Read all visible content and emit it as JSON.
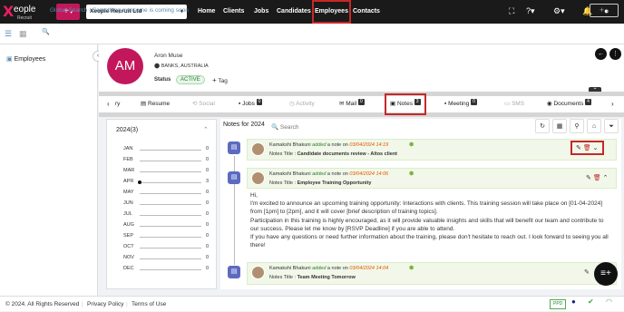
{
  "brand": {
    "logo_letter": "X",
    "logo_text": "eople",
    "logo_sub": "Recruit"
  },
  "topbar": {
    "add_label": "+",
    "company": "Xeople Recruit Ltd",
    "nav": [
      {
        "label": "Home"
      },
      {
        "label": "Clients"
      },
      {
        "label": "Jobs"
      },
      {
        "label": "Candidates"
      },
      {
        "label": "Employees"
      },
      {
        "label": "Contacts"
      }
    ]
  },
  "search": {
    "placeholder": "Global Search - Something awesome is coming soon"
  },
  "sidebar": {
    "item": "Employees"
  },
  "profile": {
    "initials": "AM",
    "name": "Aron Muse",
    "location": "BANKS, AUSTRALIA",
    "status_label": "Status",
    "status": "ACTIVE",
    "tag_label": "Tag"
  },
  "tabs": [
    {
      "label": "ry"
    },
    {
      "label": "Resume"
    },
    {
      "label": "Social"
    },
    {
      "label": "Jobs",
      "count": "0"
    },
    {
      "label": "Activity"
    },
    {
      "label": "Mail",
      "count": "0"
    },
    {
      "label": "Notes",
      "count": "3"
    },
    {
      "label": "Meeting",
      "count": "0"
    },
    {
      "label": "SMS"
    },
    {
      "label": "Documents",
      "count": "4"
    }
  ],
  "year": {
    "label": "2024(3)"
  },
  "months": [
    {
      "m": "JAN",
      "c": "0"
    },
    {
      "m": "FEB",
      "c": "0"
    },
    {
      "m": "MAR",
      "c": "0"
    },
    {
      "m": "APR",
      "c": "3"
    },
    {
      "m": "MAY",
      "c": "0"
    },
    {
      "m": "JUN",
      "c": "0"
    },
    {
      "m": "JUL",
      "c": "0"
    },
    {
      "m": "AUG",
      "c": "0"
    },
    {
      "m": "SEP",
      "c": "0"
    },
    {
      "m": "OCT",
      "c": "0"
    },
    {
      "m": "NOV",
      "c": "0"
    },
    {
      "m": "DEC",
      "c": "0"
    }
  ],
  "notes_header": "Notes for 2024",
  "notes_search": "Search",
  "notes": [
    {
      "author": "Kamakshi Bhakuni",
      "verb": "added",
      "mid": "a note on",
      "date": "03/04/2024 14:19",
      "title_label": "Notes Title :",
      "title": "Candidate documents review - Altos client"
    },
    {
      "author": "Kamakshi Bhakuni",
      "verb": "added",
      "mid": "a note on",
      "date": "03/04/2024 14:06",
      "title_label": "Notes Title :",
      "title": "Employee Training Opportunity",
      "body": [
        "Hi,",
        "I'm excited to announce an upcoming training opportunity: Interactions with clients. This training session will take place on [01-04-2024] from [1pm] to [2pm], and it will cover [brief description of training topics].",
        "Participation in this training is highly encouraged, as it will provide valuable insights and skills that will benefit our team and contribute to our success. Please let me know by [RSVP Deadline] if you are able to attend.",
        "If you have any questions or need further information about the training, please don't hesitate to reach out. I look forward to seeing you all there!"
      ]
    },
    {
      "author": "Kamakshi Bhakuni",
      "verb": "added",
      "mid": "a note on",
      "date": "03/04/2024 14:04",
      "title_label": "Notes Title :",
      "title": "Team Meeting Tomorrow"
    }
  ],
  "footer": {
    "copyright": "© 2024. All Rights Reserved",
    "privacy": "Privacy Policy",
    "terms": "Terms of Use",
    "ppd": "PPD"
  }
}
